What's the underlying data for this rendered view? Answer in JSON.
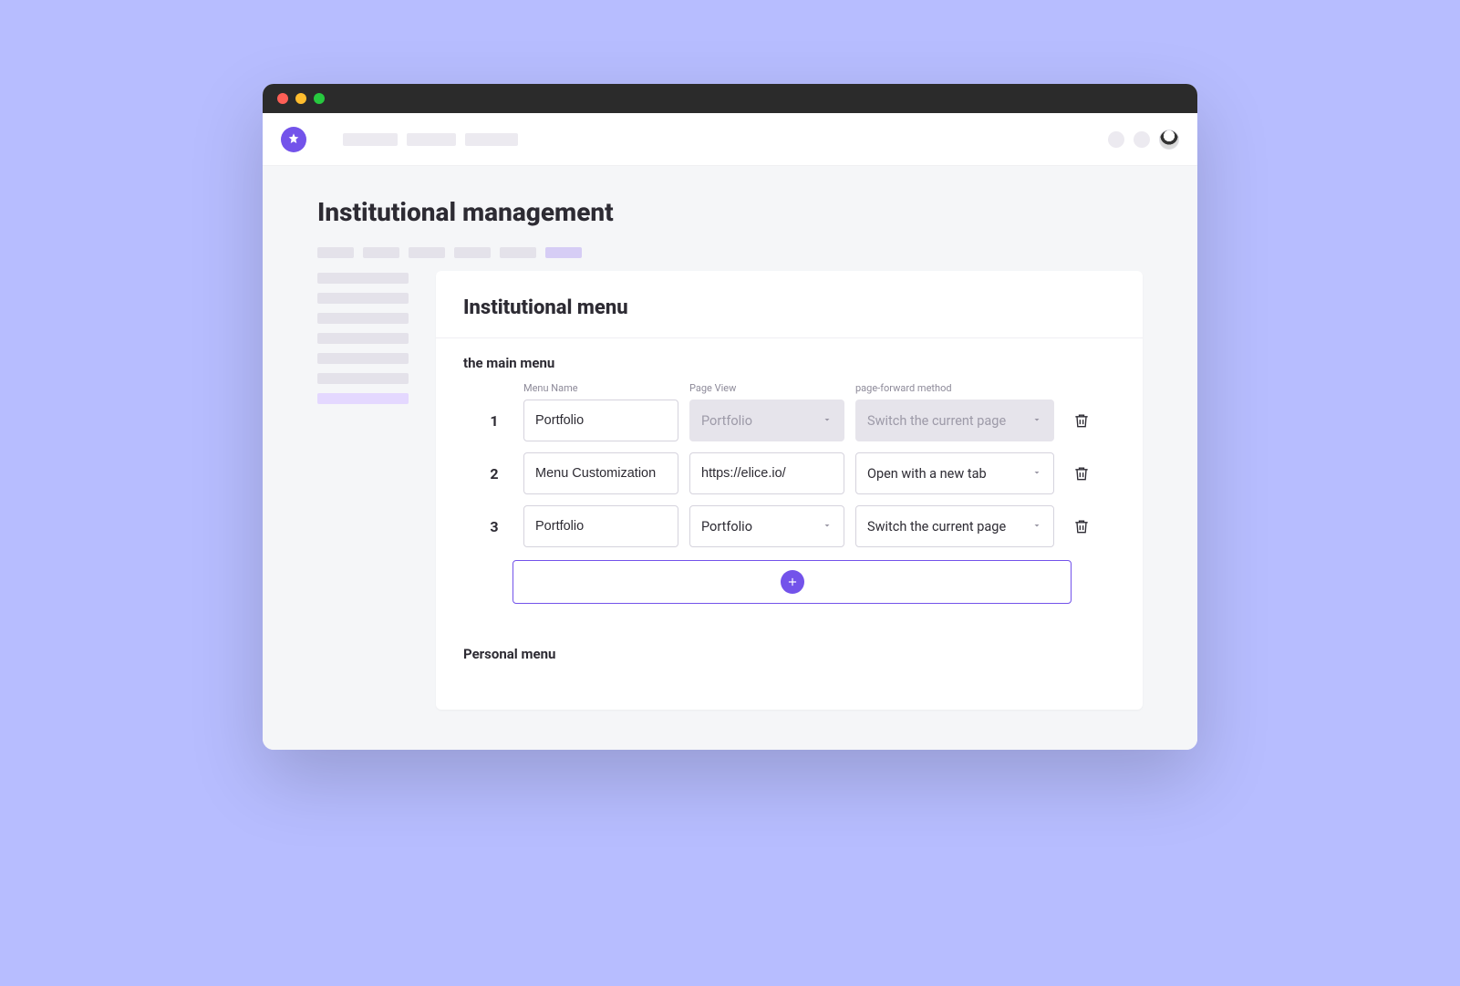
{
  "page": {
    "title": "Institutional management"
  },
  "panel": {
    "heading": "Institutional menu",
    "section_main": "the main menu",
    "section_personal": "Personal menu",
    "columns": {
      "index": "",
      "menu_name": "Menu Name",
      "page_view": "Page View",
      "forward_method": "page-forward method"
    }
  },
  "rows": [
    {
      "index": "1",
      "menu_name": "Portfolio",
      "page_view": "Portfolio",
      "forward": "Switch the current page",
      "page_view_disabled": true,
      "forward_disabled": true
    },
    {
      "index": "2",
      "menu_name": "Menu Customization",
      "page_view": "https://elice.io/",
      "forward": "Open with a new tab",
      "page_view_disabled": false,
      "forward_disabled": false
    },
    {
      "index": "3",
      "menu_name": "Portfolio",
      "page_view": "Portfolio",
      "forward": "Switch the current page",
      "page_view_disabled": false,
      "forward_disabled": false
    }
  ],
  "colors": {
    "accent": "#7353ea",
    "page_bg": "#b7bdff"
  }
}
